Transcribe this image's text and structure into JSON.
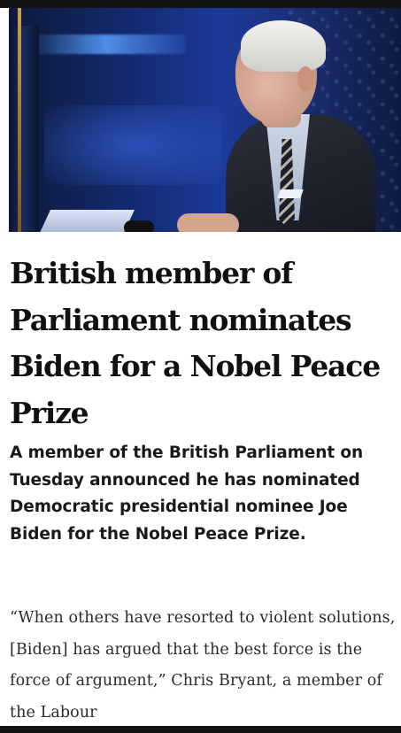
{
  "article": {
    "headline": "British member of Parliament nominates Biden for a Nobel Peace Prize",
    "summary": "A member of the British Parliament on Tuesday announced he has nominated Democratic presidential nominee Joe Biden for the Nobel Peace Prize.",
    "body_excerpt": "“When others have resorted to violent solutions, [Biden] has argued that the best force is the force of argument,” Chris Bryant, a member of the Labour"
  },
  "colors": {
    "headline": "#111111",
    "summary": "#1a1a1a",
    "body": "#2a2a2a",
    "photo_background": "#1c3a9a"
  }
}
